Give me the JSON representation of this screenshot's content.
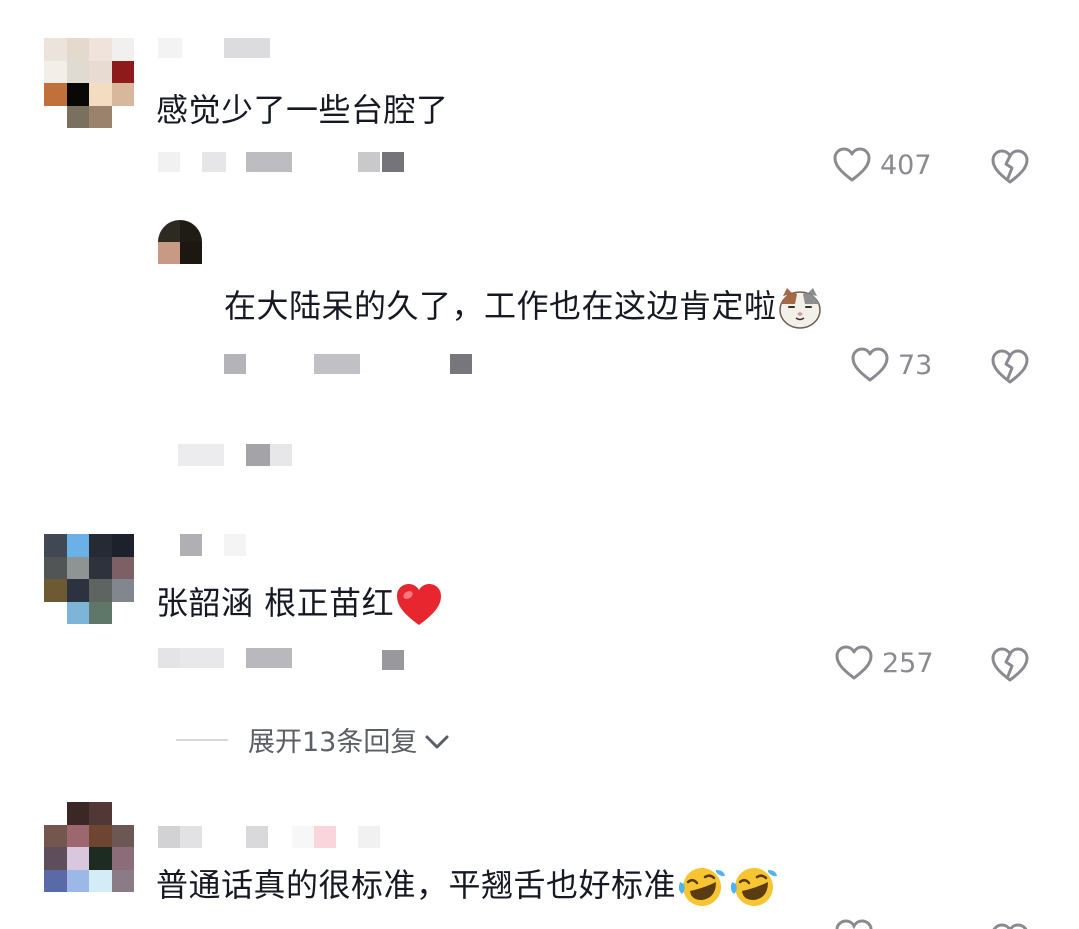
{
  "comments": [
    {
      "text": "感觉少了一些台腔了",
      "likes": "407",
      "reply": {
        "text": "在大陆呆的久了，工作也在这边肯定啦",
        "emoji": "cat-face-emoji",
        "likes": "73"
      }
    },
    {
      "text": "张韶涵 根正苗红",
      "emoji": "red-heart-emoji",
      "likes": "257",
      "expand_label": "展开13条回复"
    },
    {
      "text": "普通话真的很标准，平翘舌也好标准",
      "emoji": "tears-of-joy-emoji"
    }
  ],
  "icons": {
    "like": "heart-outline-icon",
    "dislike": "broken-heart-icon",
    "expand": "chevron-down-icon"
  },
  "colors": {
    "text": "#161823",
    "muted": "#8a8b91",
    "icon": "#8a8b91",
    "heart": "#e8262f",
    "emoji_yellow": "#f7c531"
  }
}
